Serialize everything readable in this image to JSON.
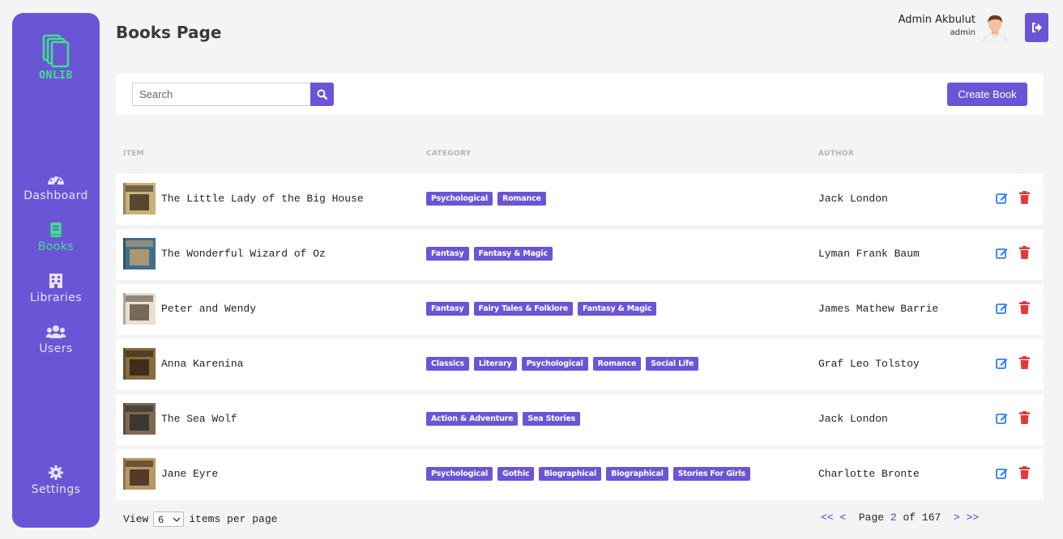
{
  "brand": {
    "name": "ONLIB"
  },
  "sidebar": {
    "items": [
      {
        "label": "Dashboard",
        "icon": "dashboard-gauge-icon",
        "active": false
      },
      {
        "label": "Books",
        "icon": "book-icon",
        "active": true
      },
      {
        "label": "Libraries",
        "icon": "building-icon",
        "active": false
      },
      {
        "label": "Users",
        "icon": "users-icon",
        "active": false
      }
    ],
    "settings_label": "Settings"
  },
  "header": {
    "title": "Books Page",
    "user_name": "Admin Akbulut",
    "user_role": "admin"
  },
  "toolbar": {
    "search_placeholder": "Search",
    "create_label": "Create Book"
  },
  "table": {
    "headers": {
      "item": "ITEM",
      "category": "CATEGORY",
      "author": "AUTHOR"
    },
    "rows": [
      {
        "title": "The Little Lady of the Big House",
        "tags": [
          "Psychological",
          "Romance"
        ],
        "author": "Jack London"
      },
      {
        "title": "The Wonderful Wizard of Oz",
        "tags": [
          "Fantasy",
          "Fantasy & Magic"
        ],
        "author": "Lyman Frank Baum"
      },
      {
        "title": "Peter and Wendy",
        "tags": [
          "Fantasy",
          "Fairy Tales & Folklore",
          "Fantasy & Magic"
        ],
        "author": "James Mathew Barrie"
      },
      {
        "title": "Anna Karenina",
        "tags": [
          "Classics",
          "Literary",
          "Psychological",
          "Romance",
          "Social Life"
        ],
        "author": "Graf Leo Tolstoy"
      },
      {
        "title": "The Sea Wolf",
        "tags": [
          "Action & Adventure",
          "Sea Stories"
        ],
        "author": "Jack London"
      },
      {
        "title": "Jane Eyre",
        "tags": [
          "Psychological",
          "Gothic",
          "Biographical",
          "Biographical",
          "Stories For Girls"
        ],
        "author": "Charlotte Bronte"
      }
    ]
  },
  "footer": {
    "view_label": "View",
    "per_page_value": "6",
    "per_page_suffix": "items per page",
    "first_label": "<<",
    "prev_label": "<",
    "page_label": "Page",
    "current_page": "2",
    "of_label": "of",
    "total_pages": "167",
    "next_label": ">",
    "last_label": ">>"
  },
  "colors": {
    "accent": "#6a55d6",
    "active_nav": "#3fe08a",
    "edit": "#2f7ff0",
    "delete": "#e03a3a"
  }
}
